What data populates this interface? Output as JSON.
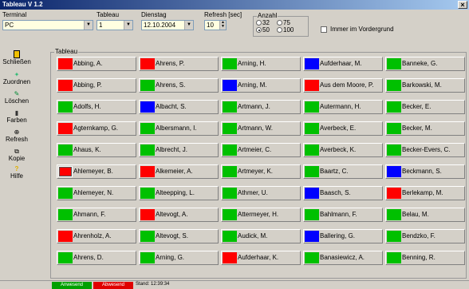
{
  "window": {
    "title": "Tableau V 1.2",
    "close_glyph": "×"
  },
  "toolbar": {
    "terminal_label": "Terminal",
    "terminal_value": "PC",
    "tableau_label": "Tableau",
    "tableau_value": "1",
    "dienstag_label": "Dienstag",
    "date_value": "12.10.2004",
    "refresh_label": "Refresh [sec]",
    "refresh_value": "10",
    "anzahl_label": "Anzahl",
    "anzahl_options": [
      "32",
      "75",
      "50",
      "100"
    ],
    "anzahl_selected": "50",
    "foreground_label": "Immer im Vordergrund"
  },
  "sidebar": {
    "items": [
      {
        "label": "Schließen",
        "icon": "door-icon"
      },
      {
        "label": "Zuordnen",
        "icon": "assign-icon"
      },
      {
        "label": "Löschen",
        "icon": "delete-icon"
      },
      {
        "label": "Farben",
        "icon": "colors-icon"
      },
      {
        "label": "Refresh",
        "icon": "refresh-icon"
      },
      {
        "label": "Kopie",
        "icon": "copy-icon"
      },
      {
        "label": "Hilfe",
        "icon": "help-icon"
      }
    ]
  },
  "tableau_group_label": "Tableau",
  "colors": {
    "red": "#ff0000",
    "green": "#00c000",
    "blue": "#0000ff"
  },
  "cells": [
    [
      {
        "name": "Abbing, A.",
        "color": "red"
      },
      {
        "name": "Ahrens, P.",
        "color": "red"
      },
      {
        "name": "Arning, H.",
        "color": "green"
      },
      {
        "name": "Aufderhaar, M.",
        "color": "blue"
      },
      {
        "name": "Banneke, G.",
        "color": "green"
      }
    ],
    [
      {
        "name": "Abbing, P.",
        "color": "red"
      },
      {
        "name": "Ahrens, S.",
        "color": "green"
      },
      {
        "name": "Arning, M.",
        "color": "blue"
      },
      {
        "name": "Aus dem Moore, P.",
        "color": "red"
      },
      {
        "name": "Barkowski, M.",
        "color": "green"
      }
    ],
    [
      {
        "name": "Adolfs, H.",
        "color": "green"
      },
      {
        "name": "Albacht, S.",
        "color": "blue"
      },
      {
        "name": "Artmann, J.",
        "color": "green"
      },
      {
        "name": "Autermann, H.",
        "color": "green"
      },
      {
        "name": "Becker, E.",
        "color": "green"
      }
    ],
    [
      {
        "name": "Agternkamp, G.",
        "color": "red"
      },
      {
        "name": "Albersmann, I.",
        "color": "green"
      },
      {
        "name": "Artmann, W.",
        "color": "green"
      },
      {
        "name": "Averbeck, E.",
        "color": "green"
      },
      {
        "name": "Becker, M.",
        "color": "green"
      }
    ],
    [
      {
        "name": "Ahaus, K.",
        "color": "green"
      },
      {
        "name": "Albrecht, J.",
        "color": "green"
      },
      {
        "name": "Artmeier, C.",
        "color": "green"
      },
      {
        "name": "Averbeck, K.",
        "color": "green"
      },
      {
        "name": "Becker-Evers, C.",
        "color": "green"
      }
    ],
    [
      {
        "name": "Ahlemeyer, B.",
        "color": "red",
        "framed": true
      },
      {
        "name": "Alkemeier, A.",
        "color": "red"
      },
      {
        "name": "Artmeyer, K.",
        "color": "green"
      },
      {
        "name": "Baartz, C.",
        "color": "green"
      },
      {
        "name": "Beckmann, S.",
        "color": "blue"
      }
    ],
    [
      {
        "name": "Ahlemeyer, N.",
        "color": "green"
      },
      {
        "name": "Alteepping, L.",
        "color": "green"
      },
      {
        "name": "Athmer, U.",
        "color": "green"
      },
      {
        "name": "Baasch, S.",
        "color": "blue"
      },
      {
        "name": "Berlekamp, M.",
        "color": "red"
      }
    ],
    [
      {
        "name": "Ahmann, F.",
        "color": "green"
      },
      {
        "name": "Altevogt, A.",
        "color": "red"
      },
      {
        "name": "Attermeyer, H.",
        "color": "green"
      },
      {
        "name": "Bahlmann, F.",
        "color": "green"
      },
      {
        "name": "Belau, M.",
        "color": "green"
      }
    ],
    [
      {
        "name": "Ahrenholz, A.",
        "color": "red"
      },
      {
        "name": "Altevogt, S.",
        "color": "green"
      },
      {
        "name": "Audick, M.",
        "color": "green"
      },
      {
        "name": "Ballering, G.",
        "color": "blue"
      },
      {
        "name": "Bendzko, F.",
        "color": "green"
      }
    ],
    [
      {
        "name": "Ahrens, D.",
        "color": "green"
      },
      {
        "name": "Arning, G.",
        "color": "green"
      },
      {
        "name": "Aufderhaar, K.",
        "color": "red"
      },
      {
        "name": "Banasiewicz, A.",
        "color": "green"
      },
      {
        "name": "Benning, R.",
        "color": "green"
      }
    ]
  ],
  "status": {
    "box1": "Anwesend",
    "box2": "Abwesend",
    "stand": "Stand: 12:39:34"
  }
}
